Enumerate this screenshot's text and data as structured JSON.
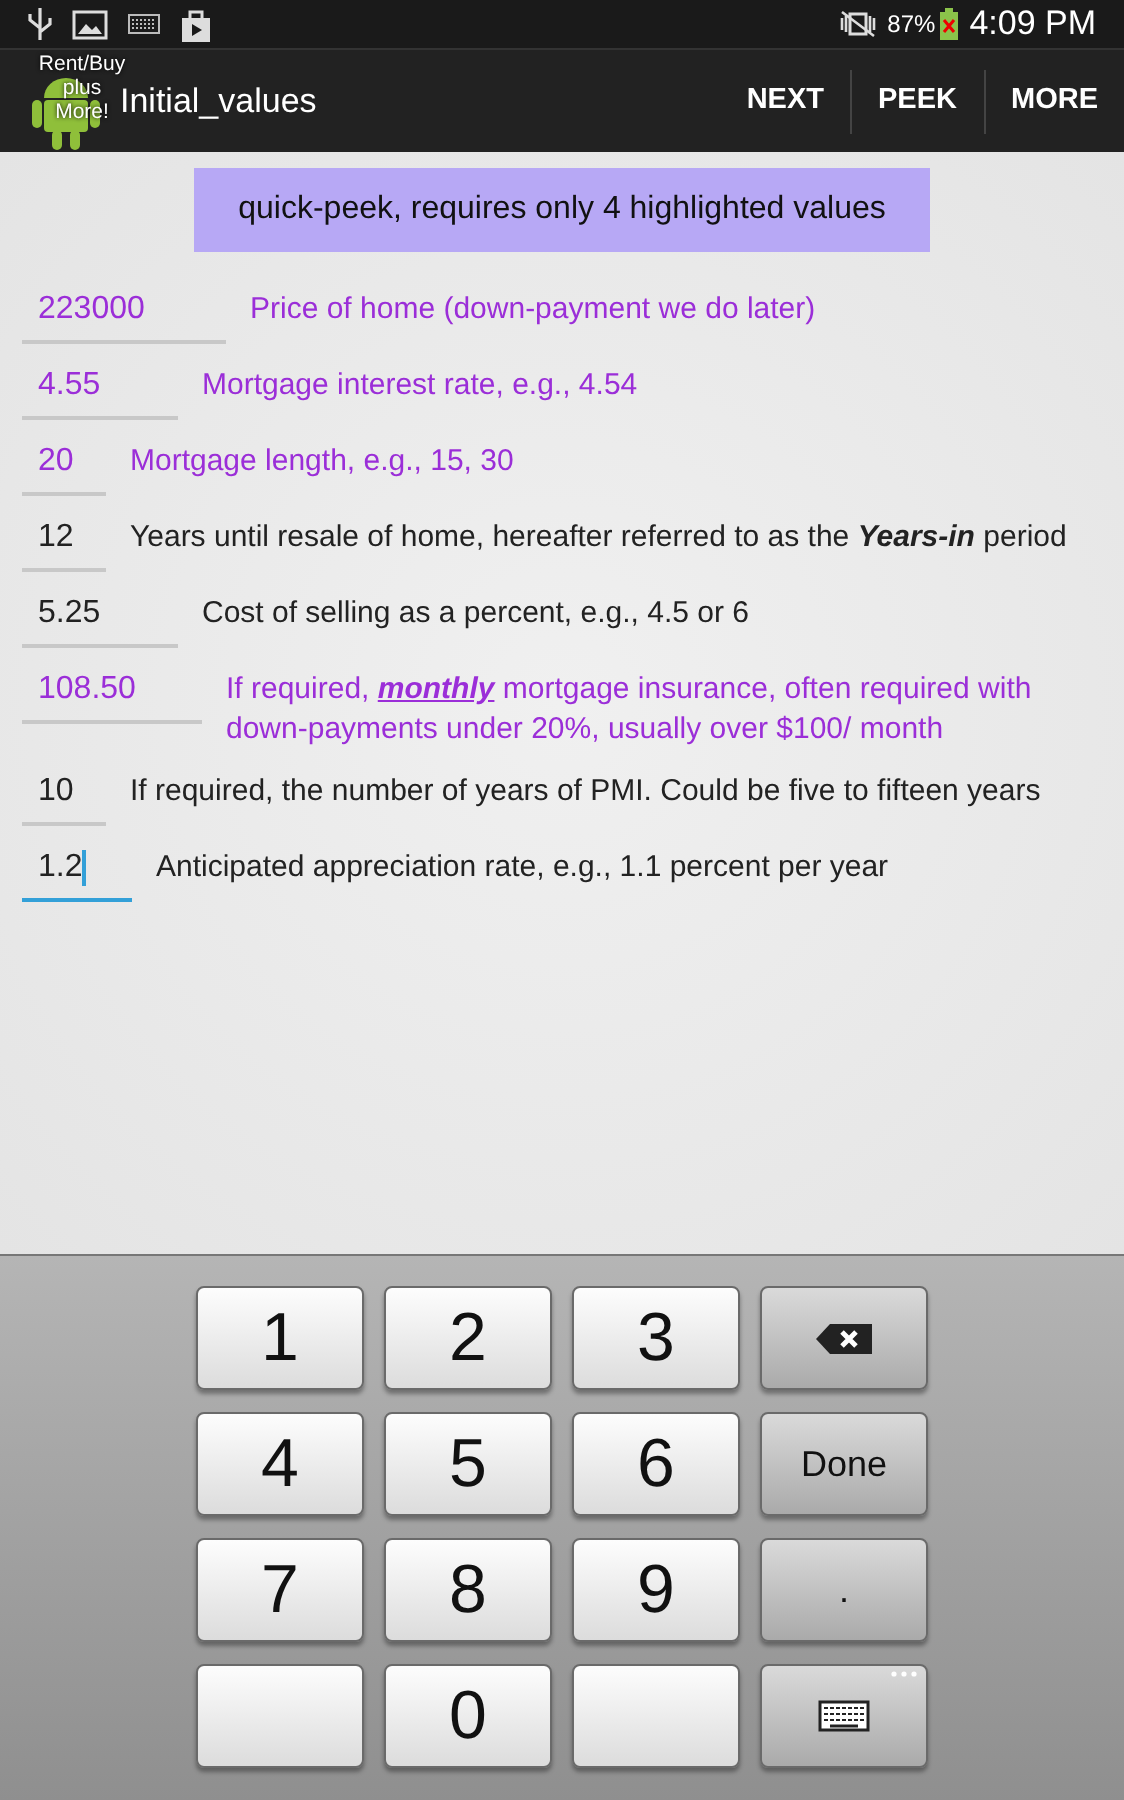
{
  "status_bar": {
    "battery": "87%",
    "time": "4:09 PM"
  },
  "action_bar": {
    "logo_lines": [
      "Rent/Buy",
      "plus",
      "More!"
    ],
    "title": "Initial_values",
    "actions": [
      "NEXT",
      "PEEK",
      "MORE"
    ]
  },
  "banner": "quick-peek, requires only 4 highlighted values",
  "fields": [
    {
      "value": "223000",
      "label": "Price of home (down-payment we do later)",
      "highlighted": true,
      "focused": false
    },
    {
      "value": "4.55",
      "label": "Mortgage interest rate, e.g., 4.54",
      "highlighted": true,
      "focused": false
    },
    {
      "value": "20",
      "label": "Mortgage length, e.g., 15, 30",
      "highlighted": true,
      "focused": false
    },
    {
      "value": "12",
      "label": "Years until resale of home, hereafter referred to as the **Years-in** period",
      "highlighted": false,
      "focused": false
    },
    {
      "value": "5.25",
      "label": "Cost of selling as a percent, e.g., 4.5 or 6",
      "highlighted": false,
      "focused": false
    },
    {
      "value": "108.50",
      "label": "If required, **monthly** mortgage insurance, often required with down-payments under 20%, usually over $100/ month",
      "highlighted": true,
      "focused": false
    },
    {
      "value": "10",
      "label": "If required, the number of years of PMI. Could be five to fifteen years",
      "highlighted": false,
      "focused": false
    },
    {
      "value": "1.2",
      "label": "Anticipated appreciation rate, e.g., 1.1 percent per year",
      "highlighted": false,
      "focused": true
    }
  ],
  "keypad": [
    {
      "kind": "digit",
      "label": "1"
    },
    {
      "kind": "digit",
      "label": "2"
    },
    {
      "kind": "digit",
      "label": "3"
    },
    {
      "kind": "backspace"
    },
    {
      "kind": "digit",
      "label": "4"
    },
    {
      "kind": "digit",
      "label": "5"
    },
    {
      "kind": "digit",
      "label": "6"
    },
    {
      "kind": "action",
      "label": "Done"
    },
    {
      "kind": "digit",
      "label": "7"
    },
    {
      "kind": "digit",
      "label": "8"
    },
    {
      "kind": "digit",
      "label": "9"
    },
    {
      "kind": "action",
      "label": "."
    },
    {
      "kind": "blank"
    },
    {
      "kind": "digit",
      "label": "0"
    },
    {
      "kind": "blank"
    },
    {
      "kind": "keyboard"
    }
  ]
}
